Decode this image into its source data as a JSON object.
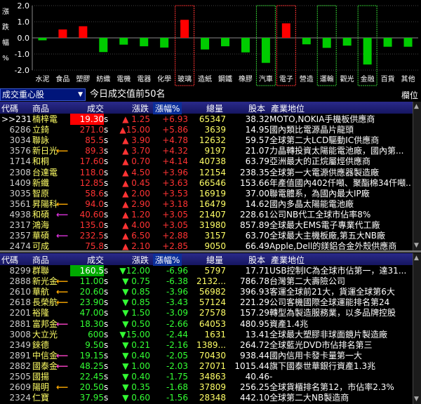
{
  "chart": {
    "y_ticks": [
      "2.0",
      "1.0",
      "0.0",
      "-1.0",
      "-2.0"
    ],
    "ylabel_chars": [
      "漲",
      "跌",
      "幅",
      "%"
    ],
    "categories": [
      "水泥",
      "食品",
      "塑膠",
      "紡織",
      "電機",
      "電器",
      "化學",
      "玻璃",
      "造紙",
      "鋼鐵",
      "橡膠",
      "汽車",
      "電子",
      "營造",
      "運輸",
      "觀光",
      "金融",
      "百貨",
      "其他"
    ],
    "values": [
      -0.15,
      0.52,
      0.72,
      -0.88,
      -0.42,
      -0.52,
      -0.6,
      1.12,
      -0.72,
      -0.52,
      -0.9,
      -1.55,
      0.9,
      -0.4,
      -0.62,
      -0.48,
      -1.65,
      -0.55,
      -0.55
    ],
    "highlight_red": [
      7,
      12
    ],
    "highlight_green": [
      11,
      14,
      16
    ],
    "up_color": "#ff0000",
    "down_color": "#00cc00"
  },
  "top_panel": {
    "title": "成交重心股",
    "subtitle": "今日成交值前50名",
    "right_label": "欄位",
    "headers": {
      "code": "代碼",
      "name": "商品",
      "price": "成交",
      "chg": "漲跌",
      "pct": "漲幅%",
      "vol": "總量",
      "cap": "股本",
      "desc": "產業地位"
    },
    "rows": [
      {
        "code": ">>2316",
        "name": "楠梓電",
        "price": "19.30",
        "s": "s",
        "chg": "▲ 1.25",
        "pct": "+6.93",
        "vol": "65347",
        "cap": "38.32",
        "desc": "MOTO,NOKIA手機板供應商",
        "limit": true
      },
      {
        "code": "6286",
        "name": "立錡",
        "price": "271.0",
        "s": "s",
        "chg": "▲15.00",
        "pct": "+5.86",
        "vol": "3639",
        "cap": "14.95",
        "desc": "國內類比電源晶片龍頭"
      },
      {
        "code": "3034",
        "name": "聯詠",
        "price": "85.5",
        "s": "s",
        "chg": "▲ 3.90",
        "pct": "+4.78",
        "vol": "12632",
        "cap": "59.57",
        "desc": "全球第二大LCD驅動IC供應商"
      },
      {
        "code": "3576",
        "name": "新日光",
        "price": "89.3",
        "s": "s",
        "chg": "▲ 3.70",
        "pct": "+4.32",
        "vol": "9197",
        "cap": "21.07",
        "desc": "力晶轉投資太陽能電池廠，國內第...",
        "arrow": "#ffaa00"
      },
      {
        "code": "1714",
        "name": "和桐",
        "price": "17.60",
        "s": "s",
        "chg": "▲ 0.70",
        "pct": "+4.14",
        "vol": "40738",
        "cap": "63.79",
        "desc": "亞洲最大的正烷屬烴供應商"
      },
      {
        "code": "2308",
        "name": "台達電",
        "price": "118.0",
        "s": "s",
        "chg": "▲ 4.50",
        "pct": "+3.96",
        "vol": "12154",
        "cap": "238.35",
        "desc": "全球第一大電源供應器製造廠"
      },
      {
        "code": "1409",
        "name": "新纖",
        "price": "12.85",
        "s": "s",
        "chg": "▲ 0.45",
        "pct": "+3.63",
        "vol": "66546",
        "cap": "153.66",
        "desc": "年產值國內402仟噸、聚酯棉34仟噸..."
      },
      {
        "code": "3035",
        "name": "智原",
        "price": "58.6",
        "s": "s",
        "chg": "▲ 2.00",
        "pct": "+3.53",
        "vol": "16919",
        "cap": "37.00",
        "desc": "聯電體系，為國內最大IP廠"
      },
      {
        "code": "3561",
        "name": "昇陽科",
        "price": "94.0",
        "s": "s",
        "chg": "▲ 2.90",
        "pct": "+3.18",
        "vol": "16479",
        "cap": "14.62",
        "desc": "國內多晶太陽能電池廠",
        "arrow": "#ffaa00"
      },
      {
        "code": "4938",
        "name": "和碩",
        "price": "40.60",
        "s": "s",
        "chg": "▲ 1.20",
        "pct": "+3.05",
        "vol": "21407",
        "cap": "228.61",
        "desc": "公司NB代工全球市佔率8%",
        "arrow": "#dd33dd"
      },
      {
        "code": "2317",
        "name": "鴻海",
        "price": "135.0",
        "s": "s",
        "chg": "▲ 4.00",
        "pct": "+3.05",
        "vol": "31980",
        "cap": "857.89",
        "desc": "全球最大EMS電子專業代工廠"
      },
      {
        "code": "2357",
        "name": "華碩",
        "price": "232.5",
        "s": "s",
        "chg": "▲ 6.50",
        "pct": "+2.88",
        "vol": "3157",
        "cap": "63.70",
        "desc": "全球最大主機板廠,第五大NB廠",
        "arrow": "#dd33dd"
      },
      {
        "code": "2474",
        "name": "可成",
        "price": "75.8",
        "s": "s",
        "chg": "▲ 2.10",
        "pct": "+2.85",
        "vol": "9050",
        "cap": "66.49",
        "desc": "Apple,Dell的鎂鋁合金外殼供應商"
      }
    ]
  },
  "bottom_panel": {
    "headers": {
      "code": "代碼",
      "name": "商品",
      "price": "成交",
      "chg": "漲跌",
      "pct": "漲幅%",
      "vol": "總量",
      "cap": "股本",
      "desc": "產業地位"
    },
    "rows": [
      {
        "code": "8299",
        "name": "群聯",
        "price": "160.5",
        "s": "s",
        "chg": "▼12.00",
        "pct": "-6.96",
        "vol": "5797",
        "cap": "17.71",
        "desc": "USB控制IC為全球市佔第一，達31...",
        "limit": true
      },
      {
        "code": "2888",
        "name": "新光金",
        "price": "11.00",
        "s": "s",
        "chg": "▼ 0.75",
        "pct": "-6.38",
        "vol": "2132...",
        "cap": "786.78",
        "desc": "台灣第二大壽險公司",
        "arrow": "#ffaa00"
      },
      {
        "code": "2610",
        "name": "華航",
        "price": "20.60",
        "s": "s",
        "chg": "▼ 0.85",
        "pct": "-3.96",
        "vol": "56982",
        "cap": "396.93",
        "desc": "客運全球前21大，貨運全球第6大",
        "arrow": "#ffaa00"
      },
      {
        "code": "2618",
        "name": "長榮航",
        "price": "23.90",
        "s": "s",
        "chg": "▼ 0.85",
        "pct": "-3.43",
        "vol": "57124",
        "cap": "221.29",
        "desc": "公司客機國際全球運能排名第24",
        "arrow": "#ffaa00"
      },
      {
        "code": "2201",
        "name": "裕隆",
        "price": "47.00",
        "s": "s",
        "chg": "▼ 1.50",
        "pct": "-3.09",
        "vol": "27578",
        "cap": "157.29",
        "desc": "轉型為製造服務業，以多品牌控股"
      },
      {
        "code": "2881",
        "name": "富邦金",
        "price": "18.30",
        "s": "s",
        "chg": "▼ 0.50",
        "pct": "-2.66",
        "vol": "64053",
        "cap": "480.95",
        "desc": "資產1.4兆",
        "arrow": "#ff44cc"
      },
      {
        "code": "3008",
        "name": "大立光",
        "price": "600",
        "s": "s",
        "chg": "▼15.00",
        "pct": "-2.44",
        "vol": "1631",
        "cap": "13.41",
        "desc": "全球最大塑膠非球面鏡片製造廠"
      },
      {
        "code": "2349",
        "name": "錸德",
        "price": "9.50",
        "s": "s",
        "chg": "▼ 0.21",
        "pct": "-2.16",
        "vol": "1389...",
        "cap": "264.72",
        "desc": "全球藍光DVD市佔排名第三"
      },
      {
        "code": "2891",
        "name": "中信金",
        "price": "19.15",
        "s": "s",
        "chg": "▼ 0.40",
        "pct": "-2.05",
        "vol": "70430",
        "cap": "938.44",
        "desc": "國內信用卡發卡量第一大",
        "arrow": "#ff44cc"
      },
      {
        "code": "2882",
        "name": "國泰金",
        "price": "48.25",
        "s": "s",
        "chg": "▼ 1.00",
        "pct": "-2.03",
        "vol": "27071",
        "cap": "1015.44",
        "desc": "旗下國泰世華銀行資產1.3兆",
        "arrow": "#ff44cc"
      },
      {
        "code": "2505",
        "name": "國揚",
        "price": "22.45",
        "s": "s",
        "chg": "▼ 0.40",
        "pct": "-1.75",
        "vol": "34863",
        "cap": "40.46",
        "desc": "-"
      },
      {
        "code": "2609",
        "name": "陽明",
        "price": "20.50",
        "s": "s",
        "chg": "▼ 0.35",
        "pct": "-1.68",
        "vol": "37809",
        "cap": "256.25",
        "desc": "全球貨櫃排名第12，市佔率2.3%",
        "arrow": "#ffaa00"
      },
      {
        "code": "2324",
        "name": "仁寶",
        "price": "37.95",
        "s": "s",
        "chg": "▼ 0.60",
        "pct": "-1.56",
        "vol": "28348",
        "cap": "442.10",
        "desc": "全球第二大NB製造商"
      }
    ]
  }
}
